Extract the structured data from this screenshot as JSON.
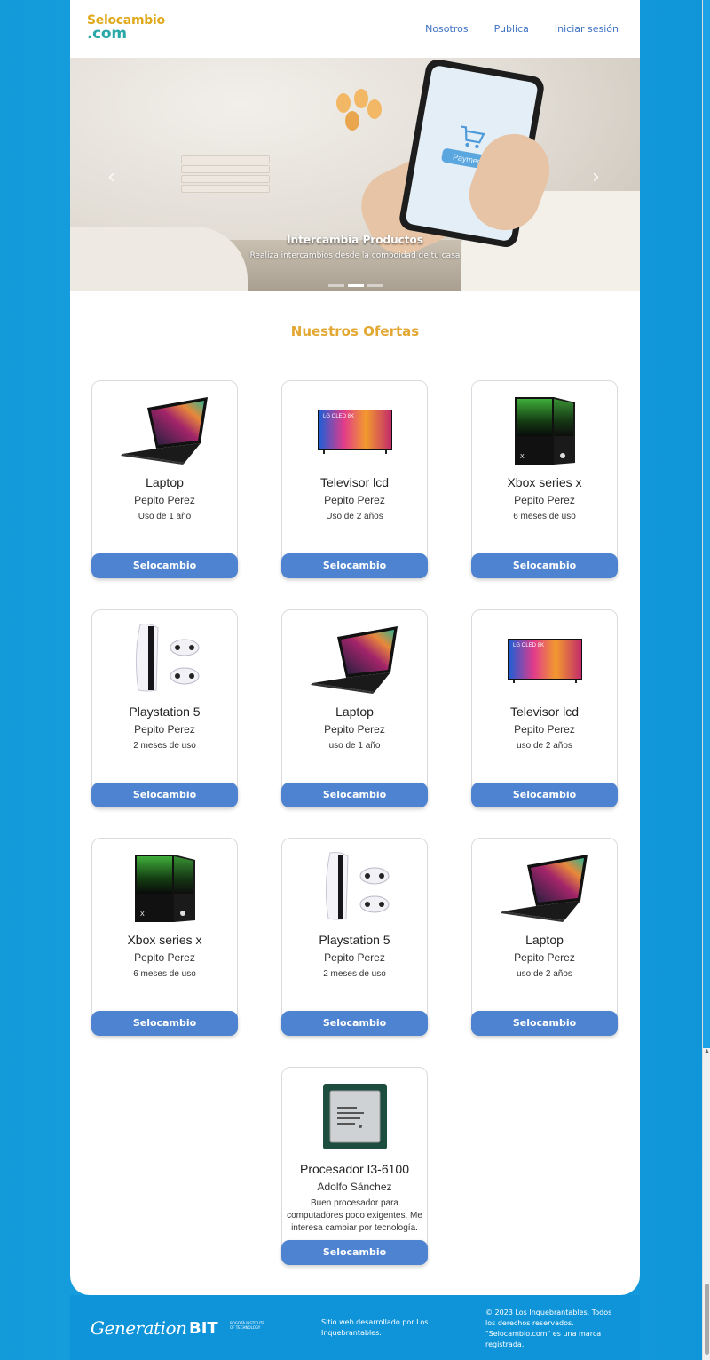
{
  "header": {
    "logo_line1": "Selocambio",
    "logo_line2": ".com",
    "nav": [
      "Nosotros",
      "Publica",
      "Iniciar sesión"
    ]
  },
  "hero": {
    "title": "Intercambia Productos",
    "subtitle": "Realiza intercambios desde la comodidad de tu casa",
    "phone_button": "Payment",
    "prev_icon": "chevron-left-icon",
    "next_icon": "chevron-right-icon",
    "slides": 3,
    "active_slide": 2
  },
  "section": {
    "title": "Nuestros Ofertas"
  },
  "cards": [
    {
      "name": "Laptop",
      "owner": "Pepito Perez",
      "desc": "Uso de 1 año",
      "image": "laptop",
      "button": "Selocambio"
    },
    {
      "name": "Televisor lcd",
      "owner": "Pepito Perez",
      "desc": "Uso de 2 años",
      "image": "tv",
      "button": "Selocambio"
    },
    {
      "name": "Xbox series x",
      "owner": "Pepito Perez",
      "desc": "6 meses de uso",
      "image": "xbox",
      "button": "Selocambio"
    },
    {
      "name": "Playstation 5",
      "owner": "Pepito Perez",
      "desc": "2 meses de uso",
      "image": "ps5",
      "button": "Selocambio"
    },
    {
      "name": "Laptop",
      "owner": "Pepito Perez",
      "desc": "uso de 1 año",
      "image": "laptop",
      "button": "Selocambio"
    },
    {
      "name": "Televisor lcd",
      "owner": "Pepito Perez",
      "desc": "uso de 2 años",
      "image": "tv",
      "button": "Selocambio"
    },
    {
      "name": "Xbox series x",
      "owner": "Pepito Perez",
      "desc": "6 meses de uso",
      "image": "xbox",
      "button": "Selocambio"
    },
    {
      "name": "Playstation 5",
      "owner": "Pepito Perez",
      "desc": "2 meses de uso",
      "image": "ps5",
      "button": "Selocambio"
    },
    {
      "name": "Laptop",
      "owner": "Pepito Perez",
      "desc": "uso de 2 años",
      "image": "laptop",
      "button": "Selocambio"
    },
    {
      "name": "Procesador I3-6100",
      "owner": "Adolfo Sánchez",
      "desc": "Buen procesador para computadores poco exigentes. Me interesa cambiar por tecnología.",
      "image": "cpu",
      "button": "Selocambio"
    }
  ],
  "footer": {
    "generation": "Generation",
    "bit": "BIT",
    "bit_sub": "BOGOTÁ INSTITUTE OF TECHNOLOGY",
    "dev": "Sitio web desarrollado por Los Inquebrantables.",
    "copy": "© 2023 Los Inquebrantables. Todos los derechos reservados. \"Selocambio.com\" es una marca registrada."
  }
}
